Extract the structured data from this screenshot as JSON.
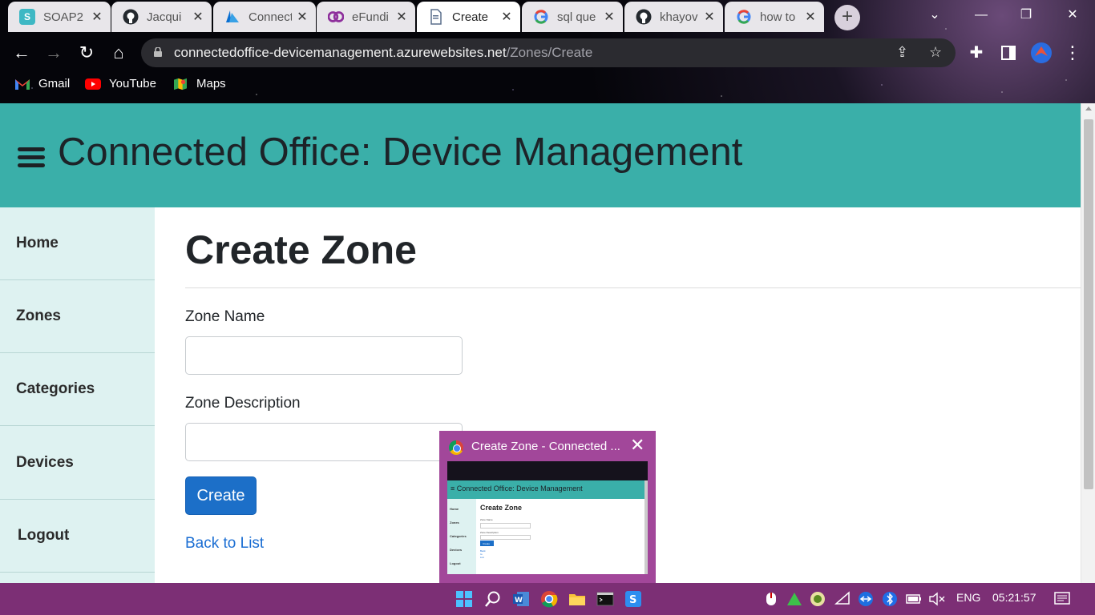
{
  "browser": {
    "tabs": [
      {
        "title": "SOAP2",
        "favicon": "soap-icon",
        "color": "#3eb8c4",
        "active": false
      },
      {
        "title": "Jacqui",
        "favicon": "github-icon",
        "color": "#24292e",
        "active": false
      },
      {
        "title": "Connect",
        "favicon": "azure-icon",
        "color": "#0a6fd1",
        "active": false
      },
      {
        "title": "eFundi",
        "favicon": "efundi-icon",
        "color": "#7b2f8c",
        "active": false
      },
      {
        "title": "Create",
        "favicon": "page-icon",
        "color": "#8aa4c8",
        "active": true
      },
      {
        "title": "sql que",
        "favicon": "google-icon",
        "color": "#4285f4",
        "active": false
      },
      {
        "title": "khayov",
        "favicon": "github-icon",
        "color": "#24292e",
        "active": false
      },
      {
        "title": "how to",
        "favicon": "google-icon",
        "color": "#4285f4",
        "active": false
      }
    ],
    "url_host": "connectedoffice-devicemanagement.azurewebsites.net",
    "url_path": "/Zones/Create",
    "bookmarks": [
      {
        "label": "Gmail",
        "icon": "gmail-icon",
        "color": "#ea4335"
      },
      {
        "label": "YouTube",
        "icon": "youtube-icon",
        "color": "#ff0000"
      },
      {
        "label": "Maps",
        "icon": "maps-icon",
        "color": "#34a853"
      }
    ]
  },
  "app": {
    "brand": "Connected Office: Device Management",
    "accent_color": "#3aafa9",
    "sidebar": [
      {
        "label": "Home"
      },
      {
        "label": "Zones"
      },
      {
        "label": "Categories"
      },
      {
        "label": "Devices"
      },
      {
        "label": "Logout"
      }
    ],
    "page_title": "Create Zone",
    "form": {
      "zone_name_label": "Zone Name",
      "zone_name_value": "",
      "zone_description_label": "Zone Description",
      "zone_description_value": "",
      "submit_label": "Create"
    },
    "back_link": "Back to List"
  },
  "preview": {
    "title": "Create Zone - Connected ...",
    "thumb_brand": "≡ Connected Office: Device Management",
    "thumb_title": "Create Zone",
    "thumb_zone_name": "Zone Name",
    "thumb_zone_description": "Zone Description",
    "thumb_button": "Create",
    "thumb_back": "Back to List",
    "thumb_sidebar": [
      "Home",
      "Zones",
      "Categories",
      "Devices",
      "Logout"
    ]
  },
  "taskbar": {
    "language": "ENG",
    "time": "05:21:57",
    "color": "#7c2f75"
  }
}
